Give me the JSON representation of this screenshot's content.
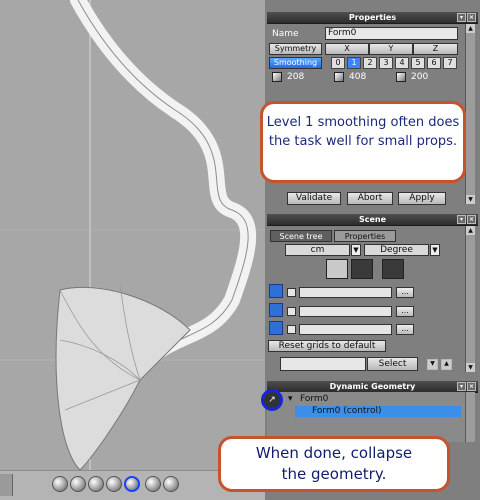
{
  "properties": {
    "title": "Properties",
    "name_label": "Name",
    "name_value": "Form0",
    "symmetry_label": "Symmetry",
    "axes": [
      "X",
      "Y",
      "Z"
    ],
    "smoothing_label": "Smoothing",
    "levels": [
      "0",
      "1",
      "2",
      "3",
      "4",
      "5",
      "6",
      "7"
    ],
    "selected_level": "1",
    "counts": [
      "208",
      "408",
      "200"
    ],
    "validate_label": "Validate",
    "abort_label": "Abort",
    "apply_label": "Apply"
  },
  "scene": {
    "title": "Scene",
    "tabs": [
      "Scene tree",
      "Properties"
    ],
    "unit_select": "cm",
    "angle_select": "Degree",
    "reset_grids_label": "Reset grids to default",
    "select_label": "Select",
    "dots_label": "..."
  },
  "dynamic_geometry": {
    "title": "Dynamic Geometry",
    "item": "Form0",
    "child_item": "Form0 (control)"
  },
  "callouts": {
    "top_line1": "Level 1 smoothing often does",
    "top_line2": "the task well for small props.",
    "bottom_line1": "When done, collapse",
    "bottom_line2": "the geometry."
  },
  "colors": {
    "accent_blue": "#3b8fe8",
    "callout_border": "#c7532d",
    "callout_text": "#1a2a7a"
  },
  "icons": {
    "title_bar_buttons": [
      "arrow-down-icon",
      "close-icon"
    ],
    "view_modes": [
      "wireframe-sphere-icon",
      "sphere-icon",
      "sphere-icon",
      "smooth-sphere-icon",
      "selected-sphere-icon",
      "shaded-sphere-icon",
      "sphere-icon"
    ]
  }
}
